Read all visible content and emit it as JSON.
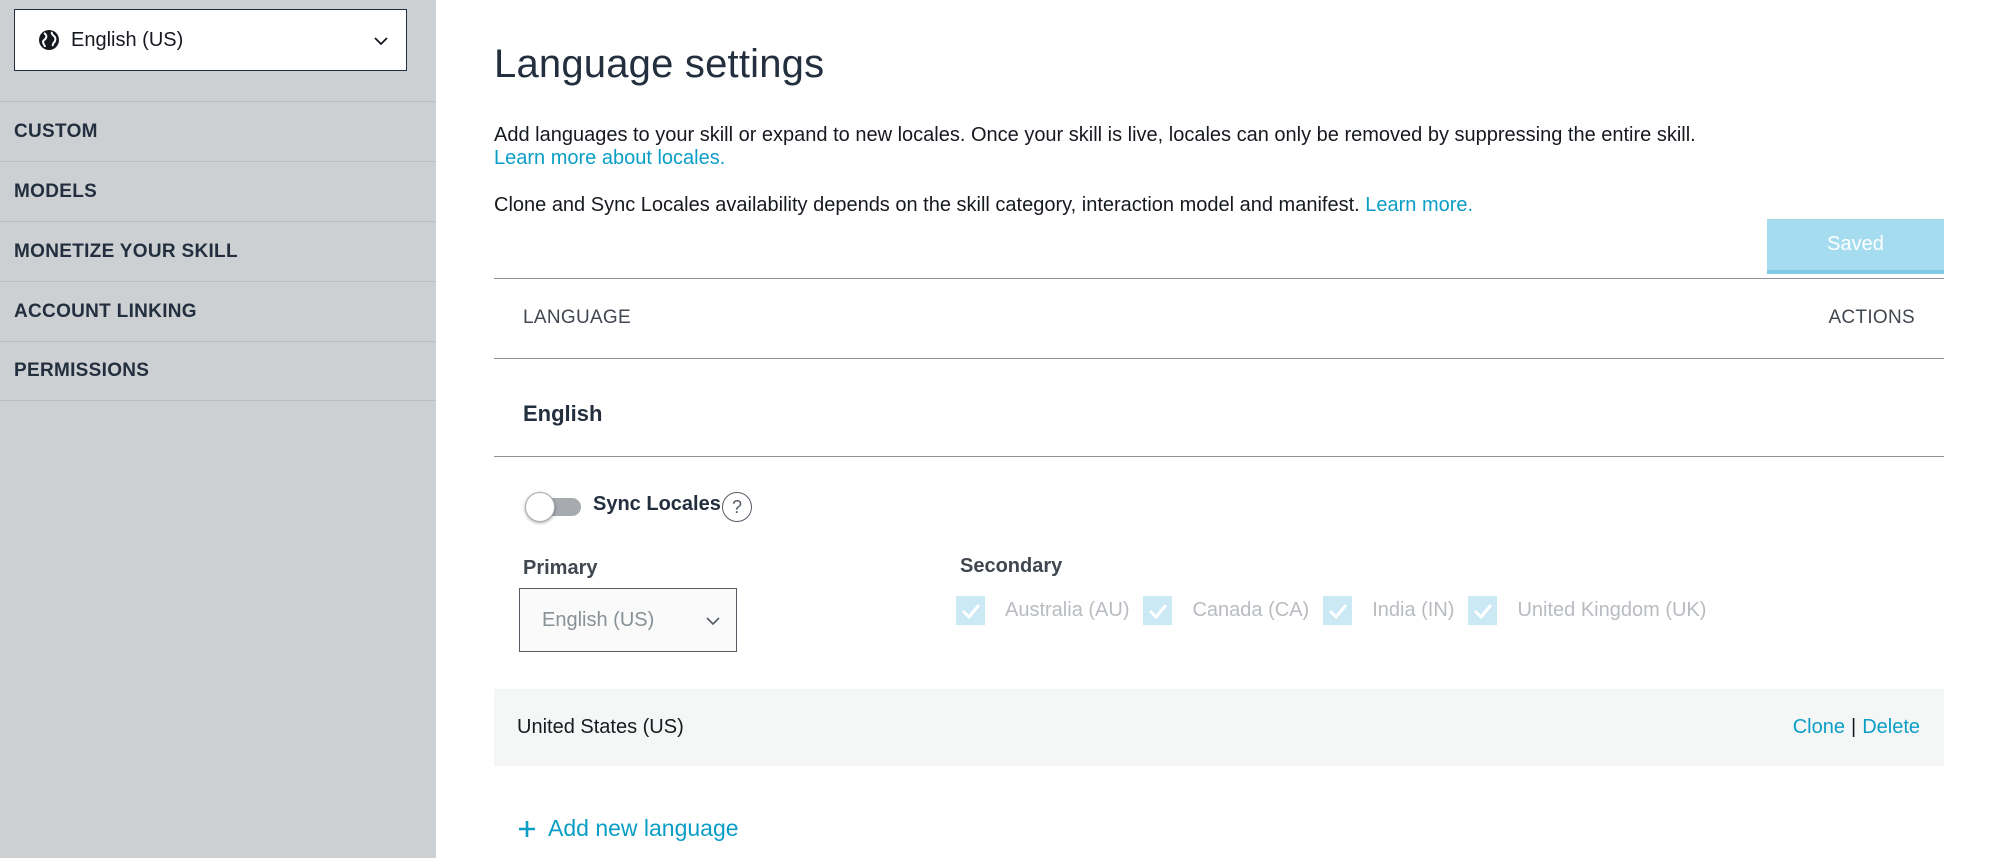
{
  "sidebar": {
    "locale_selector": {
      "label": "English (US)",
      "icon": "globe-icon"
    },
    "nav": [
      {
        "label": "CUSTOM"
      },
      {
        "label": "MODELS"
      },
      {
        "label": "MONETIZE YOUR SKILL"
      },
      {
        "label": "ACCOUNT LINKING"
      },
      {
        "label": "PERMISSIONS"
      }
    ]
  },
  "main": {
    "title": "Language settings",
    "description": "Add languages to your skill or expand to new locales. Once your skill is live, locales can only be removed by suppressing the entire skill.",
    "learn_locales_link": "Learn more about locales.",
    "clone_sync_text": "Clone and Sync Locales availability depends on the skill category, interaction model and manifest.",
    "learn_more_link": "Learn more.",
    "saved_button": "Saved",
    "table": {
      "col_language": "LANGUAGE",
      "col_actions": "ACTIONS"
    },
    "language_group": {
      "heading": "English",
      "sync_locales_label": "Sync Locales",
      "sync_locales_on": false,
      "help_glyph": "?",
      "primary_label": "Primary",
      "primary_value": "English (US)",
      "secondary_label": "Secondary",
      "secondary_locales": [
        {
          "label": "Australia (AU)",
          "checked": true
        },
        {
          "label": "Canada (CA)",
          "checked": true
        },
        {
          "label": "India (IN)",
          "checked": true
        },
        {
          "label": "United Kingdom (UK)",
          "checked": true
        }
      ],
      "locale_row": {
        "name": "United States (US)",
        "clone_label": "Clone",
        "separator": "|",
        "delete_label": "Delete"
      }
    },
    "add_language": "Add new language"
  },
  "colors": {
    "sidebar_bg": "#ccd0d3",
    "link": "#0a9ec7",
    "saved_button_bg": "#a5dcef",
    "checkbox_bg": "#cbe9f4"
  }
}
